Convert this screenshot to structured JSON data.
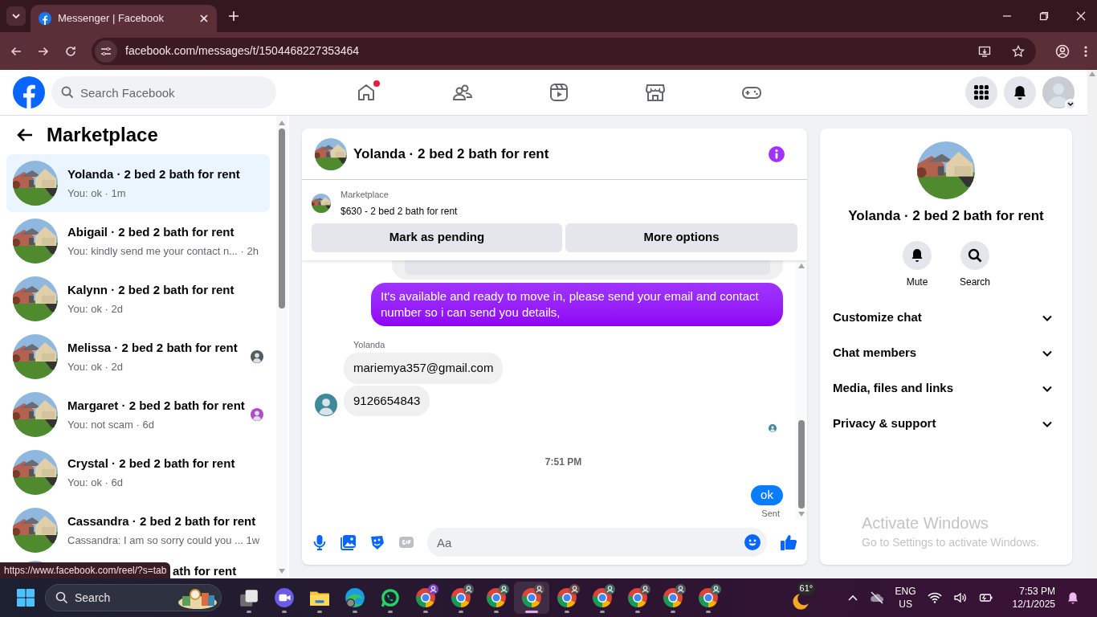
{
  "browser": {
    "tabs": [
      {
        "title": "Messenger | Facebook",
        "selected": true
      }
    ],
    "url": "facebook.com/messages/t/1504468227353464"
  },
  "header": {
    "search_placeholder": "Search Facebook",
    "nav": [
      {
        "kind": "home",
        "notification": true
      },
      {
        "kind": "friends",
        "notification": false
      },
      {
        "kind": "video",
        "notification": false
      },
      {
        "kind": "marketplace",
        "notification": false
      },
      {
        "kind": "gaming",
        "notification": false
      }
    ]
  },
  "sidebar": {
    "title": "Marketplace",
    "conversations": [
      {
        "title": "Yolanda · 2 bed 2 bath for rent",
        "preview": "You: ok · 1m",
        "selected": true,
        "read_receipt": false
      },
      {
        "title": "Abigail · 2 bed 2 bath for rent",
        "preview": "You: kindly send me your contact n... · 2h",
        "selected": false,
        "read_receipt": false
      },
      {
        "title": "Kalynn · 2 bed 2 bath for rent",
        "preview": "You: ok · 2d",
        "selected": false,
        "read_receipt": false
      },
      {
        "title": "Melissa · 2 bed 2 bath for rent",
        "preview": "You: ok · 2d",
        "selected": false,
        "read_receipt": true,
        "color": "#555b5e"
      },
      {
        "title": "Margaret · 2 bed 2 bath for rent",
        "preview": "You: not scam · 6d",
        "selected": false,
        "read_receipt": true,
        "color": "#b04cc8"
      },
      {
        "title": "Crystal · 2 bed 2 bath for rent",
        "preview": "You: ok · 6d",
        "selected": false,
        "read_receipt": false
      },
      {
        "title": "Cassandra · 2 bed 2 bath for rent",
        "preview": "Cassandra: I am so sorry could you ... 1w",
        "selected": false,
        "read_receipt": false
      }
    ],
    "partial_title": "ath for rent"
  },
  "status_url": "https://www.facebook.com/reel/?s=tab",
  "chat": {
    "title": "Yolanda · 2 bed 2 bath for rent",
    "listing": {
      "label": "Marketplace",
      "title": "$630 - 2 bed 2 bath for rent"
    },
    "buttons": [
      "Mark as pending",
      "More options"
    ],
    "messages": [
      {
        "kind": "outgoing",
        "text": "It's available and ready to move in, please send your email and contact number so i can send you details,"
      },
      {
        "kind": "incoming",
        "sender": "Yolanda",
        "text": "mariemya357@gmail.com",
        "avatar": false
      },
      {
        "kind": "incoming",
        "text": "9126654843",
        "avatar": true
      },
      {
        "kind": "seen"
      },
      {
        "kind": "time",
        "text": "7:51 PM"
      },
      {
        "kind": "outgoing_short",
        "text": "ok",
        "status": "Sent"
      }
    ],
    "composer_placeholder": "Aa"
  },
  "details": {
    "title": "Yolanda · 2 bed 2 bath for rent",
    "actions": [
      {
        "kind": "bell",
        "label": "Mute"
      },
      {
        "kind": "search",
        "label": "Search"
      }
    ],
    "sections": [
      {
        "label": "Customize chat",
        "expanded": false
      },
      {
        "label": "Chat members",
        "expanded": false
      },
      {
        "label": "Media, files and links",
        "expanded": false
      },
      {
        "label": "Privacy & support",
        "expanded": false
      }
    ]
  },
  "activation_notice": {
    "title": "Activate Windows",
    "text": "Go to Settings to activate Windows."
  },
  "taskbar": {
    "search": "Search",
    "apps": [
      {
        "kind": "taskview",
        "active": false
      },
      {
        "kind": "meet",
        "active": false
      },
      {
        "kind": "folder",
        "active": false
      },
      {
        "kind": "edge",
        "active": false
      },
      {
        "kind": "chat",
        "active": false
      },
      {
        "kind": "chrome",
        "active": false,
        "color": "#7b3fc4"
      },
      {
        "kind": "chrome",
        "active": false,
        "color": "#4a5a5a"
      },
      {
        "kind": "chrome",
        "active": false,
        "color": "#3d6a5a"
      },
      {
        "kind": "chrome",
        "active": true,
        "color": "#5a4a4a"
      },
      {
        "kind": "chrome",
        "active": false,
        "color": "#6a4a48"
      },
      {
        "kind": "chrome",
        "active": false,
        "color": "#3d6a62"
      },
      {
        "kind": "chrome",
        "active": false,
        "color": "#555555"
      },
      {
        "kind": "chrome",
        "active": false,
        "color": "#4a5a58"
      },
      {
        "kind": "chrome",
        "active": false,
        "color": "#3d6a62"
      }
    ],
    "weather": "61°",
    "language": [
      "ENG",
      "US"
    ],
    "time": "7:53 PM",
    "date": "12/1/2025"
  }
}
